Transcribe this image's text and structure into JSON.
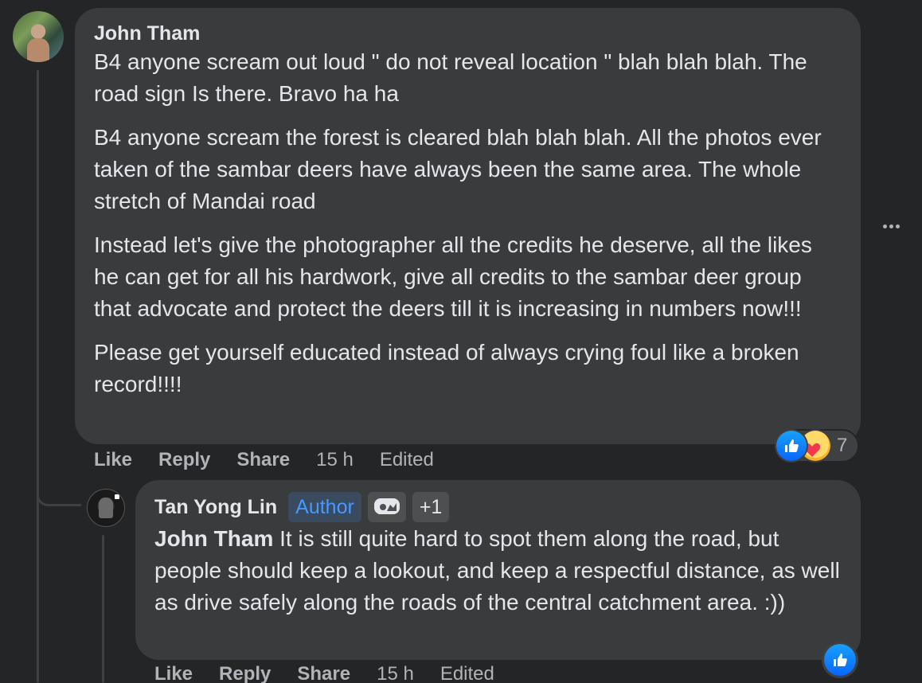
{
  "comment": {
    "author": "John Tham",
    "paragraphs": [
      "B4 anyone scream out loud \" do not reveal location \" blah blah blah. The road sign Is there. Bravo ha ha",
      "B4 anyone scream the forest is cleared blah blah blah. All the photos ever taken of the sambar deers have always been the same area. The whole stretch of Mandai road",
      "Instead let's give the photographer all the credits he deserve, all the likes he can get for all his hardwork, give all credits to the sambar deer group that advocate and protect the deers till it is increasing in numbers now!!!",
      "Please get yourself educated instead of always crying foul like a broken record!!!!"
    ],
    "actions": {
      "like": "Like",
      "reply": "Reply",
      "share": "Share",
      "time": "15 h",
      "edited": "Edited"
    },
    "reactions": {
      "count": "7",
      "types": [
        "like-icon",
        "care-icon"
      ]
    }
  },
  "reply": {
    "author": "Tan Yong Lin",
    "author_badge": "Author",
    "extra_badges": "+1",
    "mention": "John Tham",
    "text": " It is still quite hard to spot them along the road, but people should keep a lookout, and keep a respectful distance, as well as drive safely along the roads of the central catchment area. :))",
    "actions": {
      "like": "Like",
      "reply": "Reply",
      "share": "Share",
      "time": "15 h",
      "edited": "Edited"
    },
    "reactions": {
      "types": [
        "like-icon"
      ]
    }
  },
  "colors": {
    "background": "#242526",
    "bubble": "#3a3b3c",
    "text": "#e4e6eb",
    "secondary_text": "#b0b3b8",
    "author_badge_text": "#4599ff",
    "like_blue": "#0866ff"
  }
}
